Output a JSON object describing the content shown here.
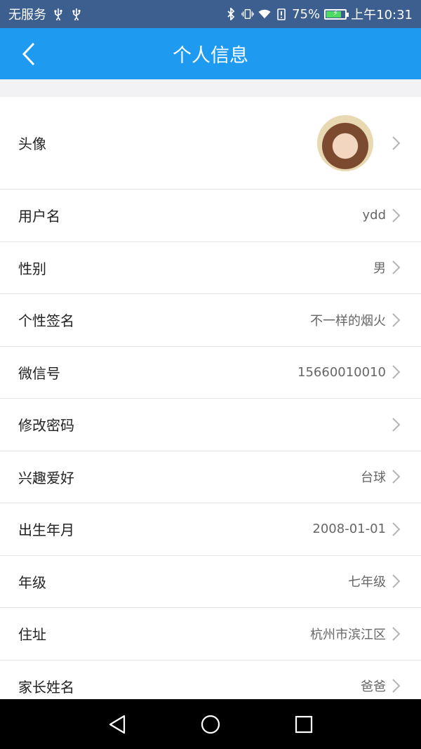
{
  "status_bar": {
    "carrier": "无服务",
    "battery": "75%",
    "battery_level": 0.75,
    "time": "上午10:31",
    "left_icons": [
      "usb-icon",
      "usb-icon"
    ],
    "right_icons": [
      "bluetooth-icon",
      "vibrate-icon",
      "wifi-icon",
      "battery-alert-icon",
      "battery-icon"
    ]
  },
  "app_bar": {
    "title": "个人信息",
    "back_icon": "chevron-left-icon",
    "color": "#1e9af0"
  },
  "profile": {
    "avatar_label": "头像",
    "rows": [
      {
        "label": "用户名",
        "value": "ydd"
      },
      {
        "label": "性别",
        "value": "男"
      },
      {
        "label": "个性签名",
        "value": "不一样的烟火"
      },
      {
        "label": "微信号",
        "value": "15660010010"
      },
      {
        "label": "修改密码",
        "value": ""
      },
      {
        "label": "兴趣爱好",
        "value": "台球"
      },
      {
        "label": "出生年月",
        "value": "2008-01-01"
      },
      {
        "label": "年级",
        "value": "七年级"
      },
      {
        "label": "住址",
        "value": "杭州市滨江区"
      },
      {
        "label": "家长姓名",
        "value": "爸爸"
      }
    ]
  },
  "nav_bar": {
    "buttons": [
      "back-triangle-icon",
      "home-circle-icon",
      "recents-square-icon"
    ]
  }
}
